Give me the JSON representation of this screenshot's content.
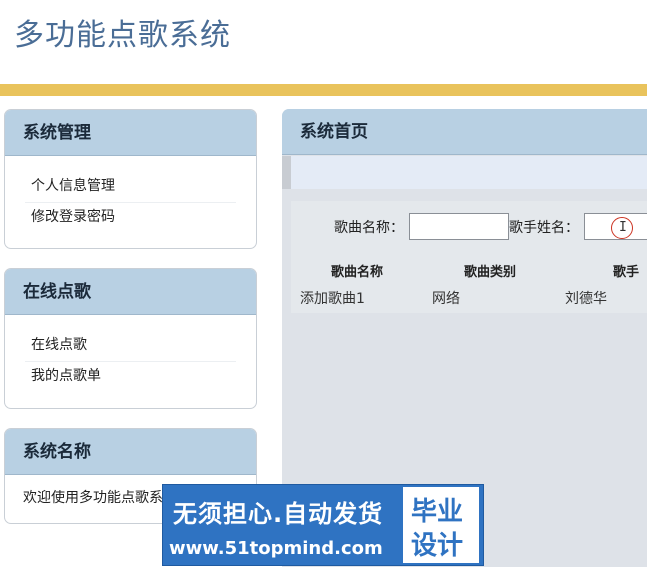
{
  "header": {
    "title": "多功能点歌系统"
  },
  "sidebar": {
    "panels": [
      {
        "title": "系统管理",
        "items": [
          {
            "label": "个人信息管理"
          },
          {
            "label": "修改登录密码"
          }
        ]
      },
      {
        "title": "在线点歌",
        "items": [
          {
            "label": "在线点歌"
          },
          {
            "label": "我的点歌单"
          }
        ]
      },
      {
        "title": "系统名称",
        "text": "欢迎使用多功能点歌系"
      }
    ]
  },
  "main": {
    "title": "系统首页",
    "search": {
      "song_label": "歌曲名称：",
      "song_value": "",
      "singer_label": "歌手姓名：",
      "singer_value": ""
    },
    "grid": {
      "columns": [
        "歌曲名称",
        "歌曲类别",
        "歌手"
      ],
      "rows": [
        [
          "添加歌曲1",
          "网络",
          "刘德华"
        ]
      ]
    }
  },
  "watermark": {
    "line1": "无须担心.自动发货",
    "line2": "www.51topmind.com",
    "badge_line1": "毕业",
    "badge_line2": "设计"
  },
  "colors": {
    "accent_bar": "#e9c35c",
    "panel_header": "#b8d0e3",
    "title_text": "#4a6d96",
    "watermark_bg": "#2f73c2"
  }
}
